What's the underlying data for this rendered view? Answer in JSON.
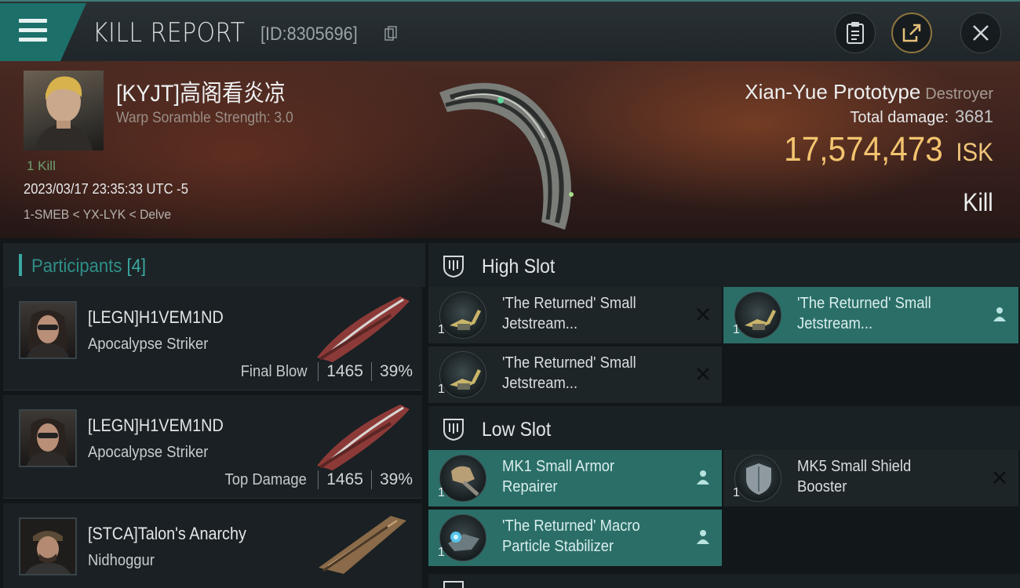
{
  "header": {
    "title": "KILL REPORT",
    "id_text": "[ID:8305696]"
  },
  "victim": {
    "name": "[KYJT]高阁看炎凉",
    "subtitle": "Warp Soramble Strength: 3.0",
    "kill_count": "1 Kill",
    "datetime": "2023/03/17 23:35:33 UTC -5",
    "location": "1-SMEB < YX-LYK < Delve",
    "ship": "Xian-Yue Prototype",
    "ship_class": "Destroyer",
    "total_damage_label": "Total damage:",
    "total_damage": "3681",
    "isk_value": "17,574,473",
    "isk_unit": "ISK",
    "result": "Kill"
  },
  "participants": {
    "label": "Participants",
    "count": "[4]",
    "rows": [
      {
        "name": "[LEGN]H1VEM1ND",
        "ship": "Apocalypse Striker",
        "tag": "Final Blow",
        "damage": "1465",
        "percent": "39%"
      },
      {
        "name": "[LEGN]H1VEM1ND",
        "ship": "Apocalypse Striker",
        "tag": "Top Damage",
        "damage": "1465",
        "percent": "39%"
      },
      {
        "name": "[STCA]Talon's Anarchy",
        "ship": "Nidhoggur",
        "tag": "",
        "damage": "",
        "percent": ""
      }
    ]
  },
  "fitting": {
    "high_slot_label": "High Slot",
    "low_slot_label": "Low Slot",
    "high_slots": [
      {
        "qty": "1",
        "name_line1": "'The Returned' Small",
        "name_line2": "Jetstream...",
        "status": "destroyed"
      },
      {
        "qty": "1",
        "name_line1": "'The Returned' Small",
        "name_line2": "Jetstream...",
        "status": "dropped"
      },
      {
        "qty": "1",
        "name_line1": "'The Returned' Small",
        "name_line2": "Jetstream...",
        "status": "destroyed"
      }
    ],
    "low_slots": [
      {
        "qty": "1",
        "name_line1": "MK1 Small Armor",
        "name_line2": "Repairer",
        "status": "dropped"
      },
      {
        "qty": "1",
        "name_line1": "MK5 Small Shield",
        "name_line2": "Booster",
        "status": "destroyed"
      },
      {
        "qty": "1",
        "name_line1": "'The Returned' Macro",
        "name_line2": "Particle Stabilizer",
        "status": "dropped"
      }
    ]
  },
  "colors": {
    "accent_teal": "#2b6e68",
    "isk_gold": "#f3c46f",
    "hero_bg": "#4a2a22"
  },
  "icons": [
    "menu-icon",
    "copy-icon",
    "clipboard-icon",
    "share-icon",
    "close-icon",
    "slot-icon",
    "destroyed-x-icon",
    "dropped-person-icon"
  ]
}
